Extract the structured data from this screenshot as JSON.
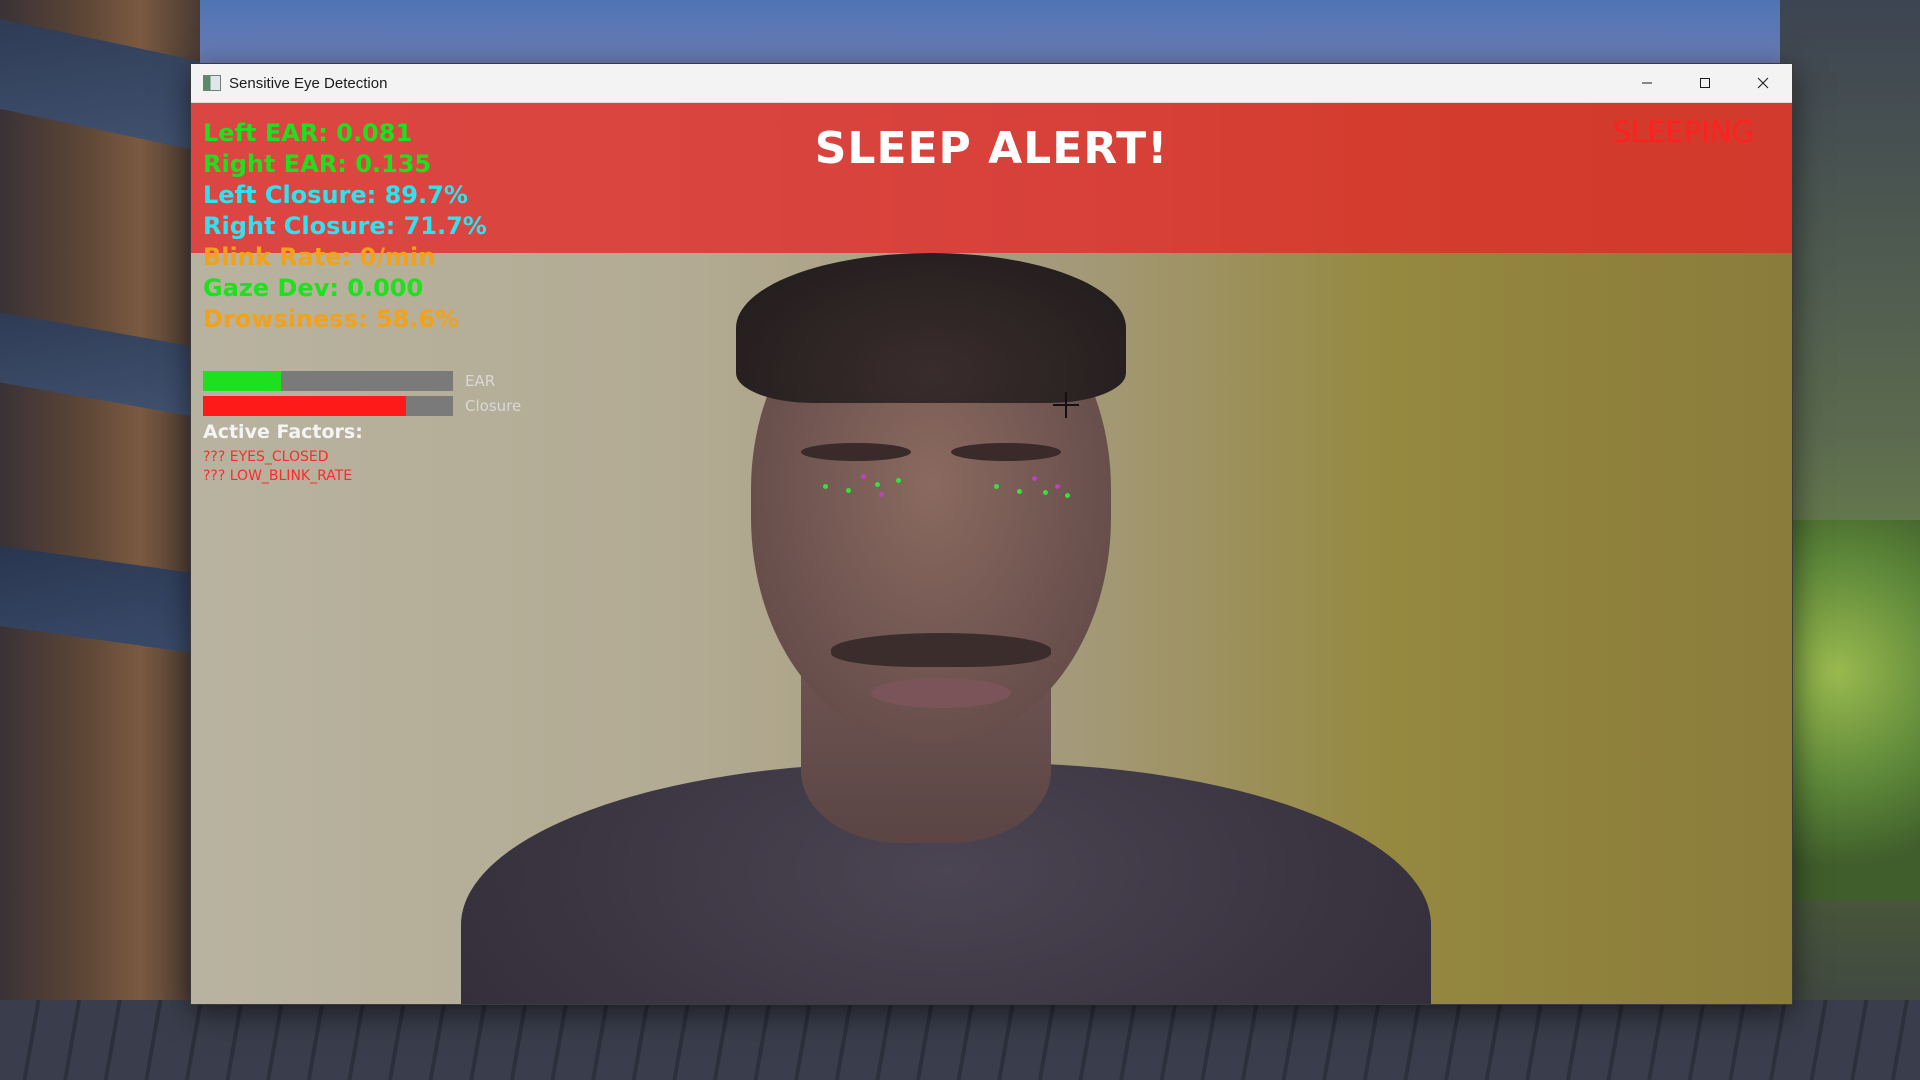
{
  "window": {
    "title": "Sensitive Eye Detection",
    "controls": [
      "minimize-icon",
      "maximize-icon",
      "close-icon"
    ]
  },
  "overlay": {
    "alert_title": "SLEEP ALERT!",
    "status": "SLEEPING",
    "alert_color": "#e62828",
    "metrics": {
      "left_ear": "Left EAR: 0.081",
      "right_ear": "Right EAR: 0.135",
      "left_closure": "Left Closure: 89.7%",
      "right_closure": "Right Closure: 71.7%",
      "blink_rate": "Blink Rate: 0/min",
      "gaze_dev": "Gaze Dev: 0.000",
      "drowsiness": "Drowsiness: 58.6%"
    },
    "bars": {
      "ear": {
        "label": "EAR",
        "fraction": 0.31,
        "color": "#1ee01e"
      },
      "closure": {
        "label": "Closure",
        "fraction": 0.81,
        "color": "#ff1a1a"
      }
    },
    "factors_title": "Active Factors:",
    "factors": [
      "??? EYES_CLOSED",
      "??? LOW_BLINK_RATE"
    ]
  }
}
